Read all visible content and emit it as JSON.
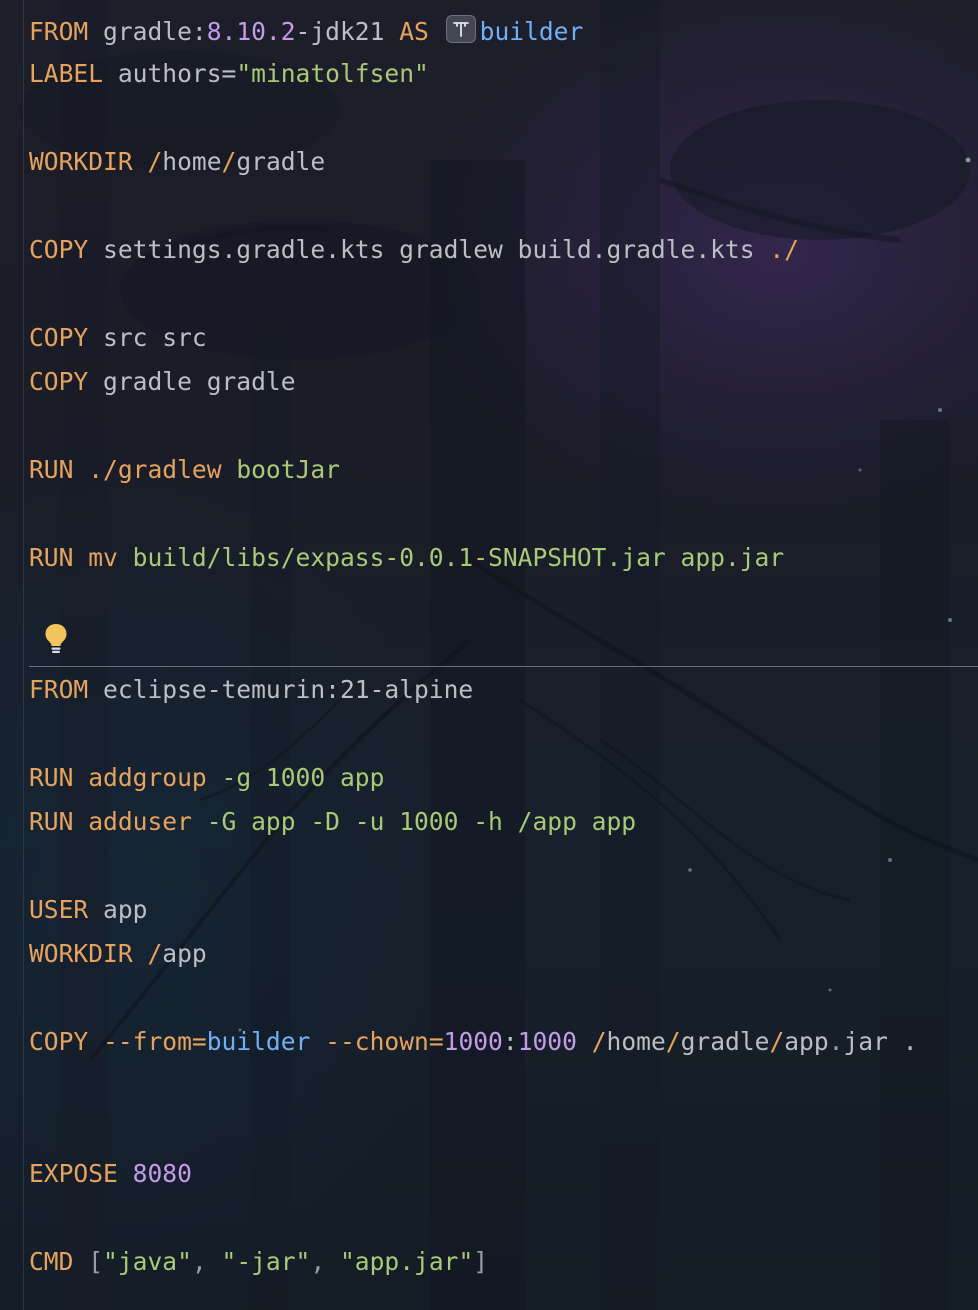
{
  "theme": {
    "keyword_color": "#e5a35e",
    "number_color": "#c49be8",
    "string_color": "#a9c977",
    "identifier_color": "#6fb0f5",
    "text_color": "#bcbec4"
  },
  "icons": {
    "type_hint": "type-parameter-icon",
    "intention": "lightbulb-icon"
  },
  "lines": {
    "l01": {
      "kw": "FROM",
      "image": "gradle:",
      "version": "8.10.2",
      "suffix": "-jdk21",
      "as": "AS",
      "alias": "builder"
    },
    "l02": {
      "kw": "LABEL",
      "key": "authors=",
      "value": "\"minatolfsen\""
    },
    "l03": {
      "kw": "WORKDIR",
      "slash1": "/",
      "p1": "home",
      "slash2": "/",
      "p2": "gradle"
    },
    "l04": {
      "kw": "COPY",
      "args": "settings.gradle.kts gradlew build.gradle.kts ",
      "dest": "./"
    },
    "l05": {
      "kw": "COPY",
      "args": "src src"
    },
    "l06": {
      "kw": "COPY",
      "args": "gradle gradle"
    },
    "l07": {
      "kw": "RUN",
      "cmd": "./gradlew",
      "arg": "bootJar"
    },
    "l08": {
      "kw": "RUN",
      "cmd": "mv",
      "arg": "build/libs/expass-0.0.1-SNAPSHOT.jar app.jar"
    },
    "l09": {
      "kw": "FROM",
      "image": "eclipse-temurin:21-alpine"
    },
    "l10": {
      "kw": "RUN",
      "cmd": "addgroup",
      "arg": "-g 1000 app"
    },
    "l11": {
      "kw": "RUN",
      "cmd": "adduser",
      "arg": "-G app -D -u 1000 -h /app app"
    },
    "l12": {
      "kw": "USER",
      "arg": "app"
    },
    "l13": {
      "kw": "WORKDIR",
      "slash": "/",
      "p": "app"
    },
    "l14": {
      "kw": "COPY",
      "flag1": "--from=",
      "alias": "builder",
      "flag2": "--chown=",
      "uid": "1000",
      "colon": ":",
      "gid": "1000",
      "s1": "/",
      "p1": "home",
      "s2": "/",
      "p2": "gradle",
      "s3": "/",
      "file": "app",
      "dot": ".",
      "ext": "jar",
      "dest": "."
    },
    "l15": {
      "kw": "EXPOSE",
      "port": "8080"
    },
    "l16": {
      "kw": "CMD",
      "open": "[",
      "a1": "\"java\"",
      "c1": ", ",
      "a2": "\"-jar\"",
      "c2": ", ",
      "a3": "\"app.jar\"",
      "close": "]"
    }
  }
}
